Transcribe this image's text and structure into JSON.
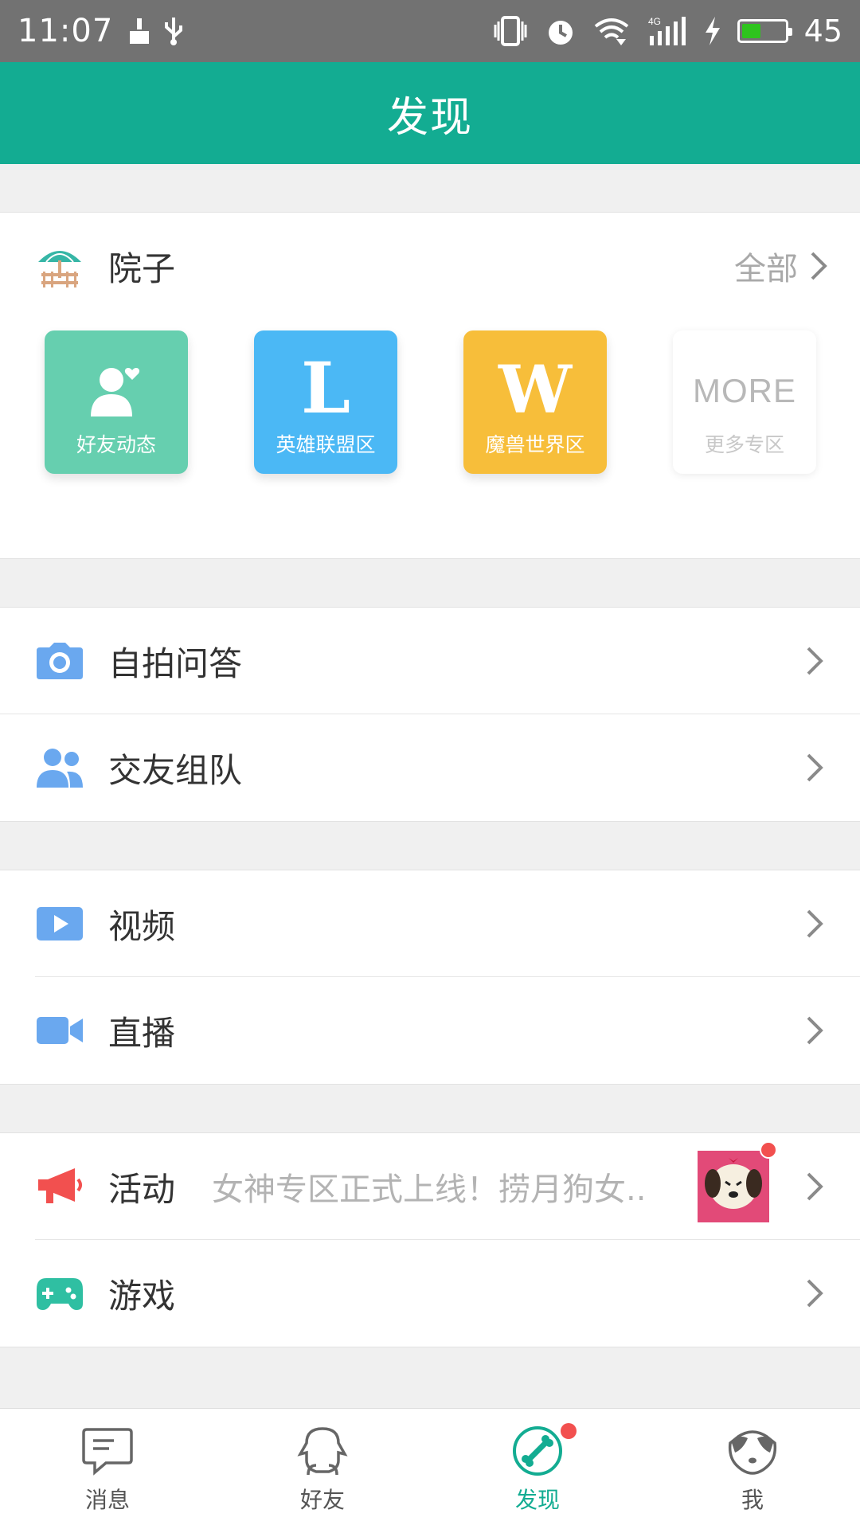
{
  "status_bar": {
    "time": "11:07",
    "network": "4G",
    "battery": "45",
    "battery_level": 0.45
  },
  "header": {
    "title": "发现"
  },
  "yard": {
    "title": "院子",
    "all_label": "全部",
    "tiles": [
      {
        "label": "好友动态",
        "icon": "friend-heart-icon",
        "color": "#66cfaf"
      },
      {
        "label": "英雄联盟区",
        "glyph": "L",
        "color": "#4bb8f5"
      },
      {
        "label": "魔兽世界区",
        "glyph": "W",
        "color": "#f7be3a"
      },
      {
        "label": "更多专区",
        "glyph": "MORE",
        "color": "#ffffff"
      }
    ]
  },
  "rows": {
    "selfie_qa": "自拍问答",
    "team_up": "交友组队",
    "video": "视频",
    "live": "直播",
    "activity": "活动",
    "activity_desc": "女神专区正式上线！捞月狗女..",
    "games": "游戏"
  },
  "bottom_nav": [
    {
      "label": "消息",
      "icon": "message-icon"
    },
    {
      "label": "好友",
      "icon": "friend-icon"
    },
    {
      "label": "发现",
      "icon": "discover-icon",
      "active": true
    },
    {
      "label": "我",
      "icon": "me-icon"
    }
  ],
  "colors": {
    "brand": "#13ac92",
    "icon_blue": "#6aa8ef",
    "alert_red": "#f2504f"
  }
}
